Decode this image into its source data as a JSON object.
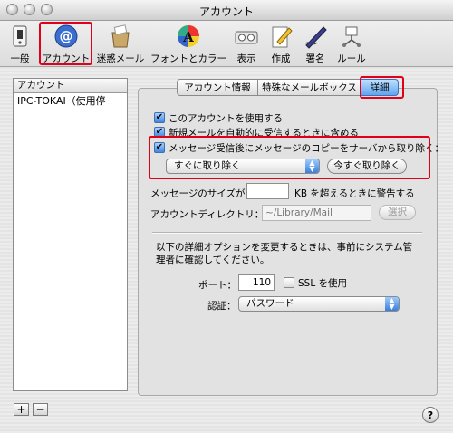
{
  "window": {
    "title": "アカウント"
  },
  "toolbar": {
    "items": [
      {
        "label": "一般",
        "icon": "general-switch-icon"
      },
      {
        "label": "アカウント",
        "icon": "at-sign-icon"
      },
      {
        "label": "迷惑メール",
        "icon": "junk-mail-bin-icon"
      },
      {
        "label": "フォントとカラー",
        "icon": "font-color-icon"
      },
      {
        "label": "表示",
        "icon": "viewing-icon"
      },
      {
        "label": "作成",
        "icon": "compose-pencil-icon"
      },
      {
        "label": "署名",
        "icon": "signature-pen-icon"
      },
      {
        "label": "ルール",
        "icon": "rules-arrows-icon"
      }
    ]
  },
  "sidebar": {
    "header": "アカウント",
    "accounts": [
      "IPC-TOKAI（使用停"
    ],
    "add_label": "+",
    "remove_label": "−"
  },
  "tabs": [
    {
      "label": "アカウント情報"
    },
    {
      "label": "特殊なメールボックス"
    },
    {
      "label": "詳細"
    }
  ],
  "options": {
    "enable_account": "このアカウントを使用する",
    "include_auto_check": "新規メールを自動的に受信するときに含める",
    "remove_copy": "メッセージ受信後にメッセージのコピーをサーバから取り除く：",
    "remove_when_value": "すぐに取り除く",
    "remove_now_button": "今すぐ取り除く",
    "size_warning_prefix": "メッセージのサイズが",
    "size_warning_value": "",
    "size_warning_suffix": "KB を超えるときに警告する",
    "account_dir_label": "アカウントディレクトリ：",
    "account_dir_value": "~/Library/Mail",
    "choose_button": "選択",
    "admin_note": "以下の詳細オプションを変更するときは、事前にシステム管理者に確認してください。",
    "port_label": "ポート：",
    "port_value": "110",
    "ssl_label": "SSL を使用",
    "auth_label": "認証：",
    "auth_value": "パスワード"
  },
  "help_label": "?",
  "colors": {
    "highlight_red": "#e0001a",
    "aqua_blue": "#3d86e0"
  }
}
